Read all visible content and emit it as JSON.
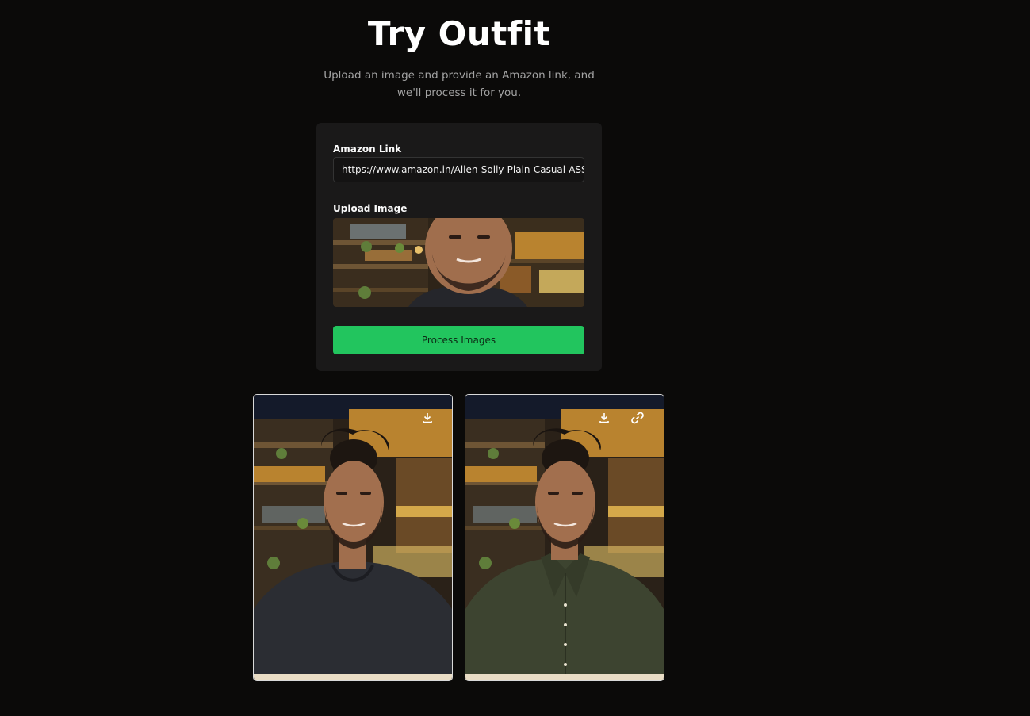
{
  "header": {
    "title": "Try Outfit",
    "subtitle": "Upload an image and provide an Amazon link, and we'll process it for you."
  },
  "form": {
    "amazon_link_label": "Amazon Link",
    "amazon_link_value": "https://www.amazon.in/Allen-Solly-Plain-Casual-ASSF",
    "upload_label": "Upload Image",
    "process_button_label": "Process Images"
  },
  "results": [
    {
      "name": "original",
      "actions": [
        "download-icon"
      ],
      "shirt_color": "#2b2d33"
    },
    {
      "name": "outfit-applied",
      "actions": [
        "download-icon",
        "link-icon"
      ],
      "shirt_color": "#3d4430"
    }
  ],
  "colors": {
    "background": "#0b0a09",
    "card": "#1a1919",
    "accent": "#22c55e",
    "subtitle": "#a3a3a3"
  }
}
